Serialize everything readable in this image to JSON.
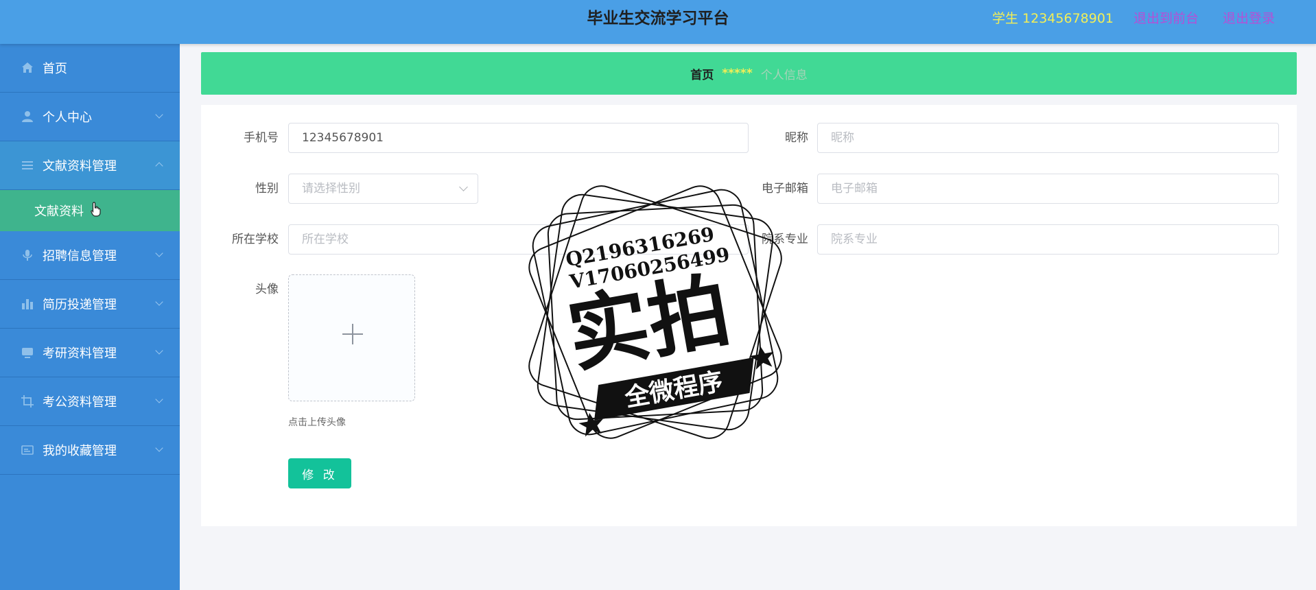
{
  "header": {
    "title": "毕业生交流学习平台",
    "user": "学生 12345678901",
    "front_link": "退出到前台",
    "logout_link": "退出登录"
  },
  "sidebar": {
    "items": [
      {
        "label": "首页",
        "icon": "home-icon"
      },
      {
        "label": "个人中心",
        "icon": "user-icon"
      },
      {
        "label": "文献资料管理",
        "icon": "list-icon"
      },
      {
        "label": "招聘信息管理",
        "icon": "microphone-icon"
      },
      {
        "label": "简历投递管理",
        "icon": "bar-chart-icon"
      },
      {
        "label": "考研资料管理",
        "icon": "monitor-icon"
      },
      {
        "label": "考公资料管理",
        "icon": "crop-icon"
      },
      {
        "label": "我的收藏管理",
        "icon": "card-icon"
      }
    ],
    "sub_item": "文献资料"
  },
  "breadcrumb": {
    "home": "首页",
    "separator": "*****",
    "current": "个人信息"
  },
  "form": {
    "phone_label": "手机号",
    "phone_value": "12345678901",
    "nickname_label": "昵称",
    "nickname_placeholder": "昵称",
    "gender_label": "性别",
    "gender_placeholder": "请选择性别",
    "email_label": "电子邮箱",
    "email_placeholder": "电子邮箱",
    "school_label": "所在学校",
    "school_placeholder": "所在学校",
    "major_label": "院系专业",
    "major_placeholder": "院系专业",
    "avatar_label": "头像",
    "upload_tip": "点击上传头像",
    "submit_label": "修 改"
  },
  "watermark": {
    "line1": "Q2196316269",
    "line2": "V17060256499",
    "main": "实拍",
    "banner": "全微程序"
  },
  "colors": {
    "header_bg": "#4a9fe6",
    "sidebar_bg": "#3a8ad8",
    "active_sub_bg": "#3fb48d",
    "breadcrumb_bg": "#41d995",
    "button_bg": "#13c29a",
    "user_text": "#f3ef56",
    "link_text": "#b54fd6"
  }
}
